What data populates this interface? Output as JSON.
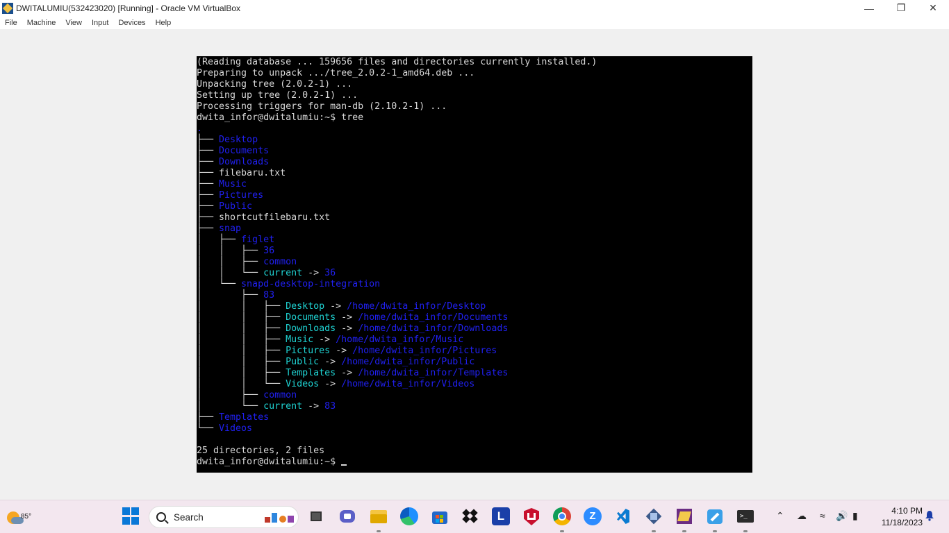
{
  "window": {
    "title": "DWITALUMIU(532423020) [Running] - Oracle VM VirtualBox",
    "controls": [
      "minimize-icon",
      "restore-icon",
      "close-icon"
    ]
  },
  "menu": [
    "File",
    "Machine",
    "View",
    "Input",
    "Devices",
    "Help"
  ],
  "terminal": {
    "lines": [
      [
        {
          "t": "(Reading database ... 159656 files and directories currently installed.)",
          "c": ""
        }
      ],
      [
        {
          "t": "Preparing to unpack .../tree_2.0.2-1_amd64.deb ...",
          "c": ""
        }
      ],
      [
        {
          "t": "Unpacking tree (2.0.2-1) ...",
          "c": ""
        }
      ],
      [
        {
          "t": "Setting up tree (2.0.2-1) ...",
          "c": ""
        }
      ],
      [
        {
          "t": "Processing triggers for man-db (2.10.2-1) ...",
          "c": ""
        }
      ],
      [
        {
          "t": "dwita_infor@dwitalumiu:~$ tree",
          "c": ""
        }
      ],
      [
        {
          "t": ".",
          "c": "dir"
        }
      ],
      [
        {
          "t": "├── ",
          "c": ""
        },
        {
          "t": "Desktop",
          "c": "dir"
        }
      ],
      [
        {
          "t": "├── ",
          "c": ""
        },
        {
          "t": "Documents",
          "c": "dir"
        }
      ],
      [
        {
          "t": "├── ",
          "c": ""
        },
        {
          "t": "Downloads",
          "c": "dir"
        }
      ],
      [
        {
          "t": "├── filebaru.txt",
          "c": ""
        }
      ],
      [
        {
          "t": "├── ",
          "c": ""
        },
        {
          "t": "Music",
          "c": "dir"
        }
      ],
      [
        {
          "t": "├── ",
          "c": ""
        },
        {
          "t": "Pictures",
          "c": "dir"
        }
      ],
      [
        {
          "t": "├── ",
          "c": ""
        },
        {
          "t": "Public",
          "c": "dir"
        }
      ],
      [
        {
          "t": "├── shortcutfilebaru.txt",
          "c": ""
        }
      ],
      [
        {
          "t": "├── ",
          "c": ""
        },
        {
          "t": "snap",
          "c": "dir"
        }
      ],
      [
        {
          "t": "│   ├── ",
          "c": ""
        },
        {
          "t": "figlet",
          "c": "dir"
        }
      ],
      [
        {
          "t": "│   │   ├── ",
          "c": ""
        },
        {
          "t": "36",
          "c": "dir"
        }
      ],
      [
        {
          "t": "│   │   ├── ",
          "c": ""
        },
        {
          "t": "common",
          "c": "dir"
        }
      ],
      [
        {
          "t": "│   │   └── ",
          "c": ""
        },
        {
          "t": "current",
          "c": "lnk"
        },
        {
          "t": " -> ",
          "c": ""
        },
        {
          "t": "36",
          "c": "tgt"
        }
      ],
      [
        {
          "t": "│   └── ",
          "c": ""
        },
        {
          "t": "snapd-desktop-integration",
          "c": "dir"
        }
      ],
      [
        {
          "t": "│       ├── ",
          "c": ""
        },
        {
          "t": "83",
          "c": "dir"
        }
      ],
      [
        {
          "t": "│       │   ├── ",
          "c": ""
        },
        {
          "t": "Desktop",
          "c": "lnk"
        },
        {
          "t": " -> ",
          "c": ""
        },
        {
          "t": "/home/dwita_infor/Desktop",
          "c": "tgt"
        }
      ],
      [
        {
          "t": "│       │   ├── ",
          "c": ""
        },
        {
          "t": "Documents",
          "c": "lnk"
        },
        {
          "t": " -> ",
          "c": ""
        },
        {
          "t": "/home/dwita_infor/Documents",
          "c": "tgt"
        }
      ],
      [
        {
          "t": "│       │   ├── ",
          "c": ""
        },
        {
          "t": "Downloads",
          "c": "lnk"
        },
        {
          "t": " -> ",
          "c": ""
        },
        {
          "t": "/home/dwita_infor/Downloads",
          "c": "tgt"
        }
      ],
      [
        {
          "t": "│       │   ├── ",
          "c": ""
        },
        {
          "t": "Music",
          "c": "lnk"
        },
        {
          "t": " -> ",
          "c": ""
        },
        {
          "t": "/home/dwita_infor/Music",
          "c": "tgt"
        }
      ],
      [
        {
          "t": "│       │   ├── ",
          "c": ""
        },
        {
          "t": "Pictures",
          "c": "lnk"
        },
        {
          "t": " -> ",
          "c": ""
        },
        {
          "t": "/home/dwita_infor/Pictures",
          "c": "tgt"
        }
      ],
      [
        {
          "t": "│       │   ├── ",
          "c": ""
        },
        {
          "t": "Public",
          "c": "lnk"
        },
        {
          "t": " -> ",
          "c": ""
        },
        {
          "t": "/home/dwita_infor/Public",
          "c": "tgt"
        }
      ],
      [
        {
          "t": "│       │   ├── ",
          "c": ""
        },
        {
          "t": "Templates",
          "c": "lnk"
        },
        {
          "t": " -> ",
          "c": ""
        },
        {
          "t": "/home/dwita_infor/Templates",
          "c": "tgt"
        }
      ],
      [
        {
          "t": "│       │   └── ",
          "c": ""
        },
        {
          "t": "Videos",
          "c": "lnk"
        },
        {
          "t": " -> ",
          "c": ""
        },
        {
          "t": "/home/dwita_infor/Videos",
          "c": "tgt"
        }
      ],
      [
        {
          "t": "│       ├── ",
          "c": ""
        },
        {
          "t": "common",
          "c": "dir"
        }
      ],
      [
        {
          "t": "│       └── ",
          "c": ""
        },
        {
          "t": "current",
          "c": "lnk"
        },
        {
          "t": " -> ",
          "c": ""
        },
        {
          "t": "83",
          "c": "tgt"
        }
      ],
      [
        {
          "t": "├── ",
          "c": ""
        },
        {
          "t": "Templates",
          "c": "dir"
        }
      ],
      [
        {
          "t": "└── ",
          "c": ""
        },
        {
          "t": "Videos",
          "c": "dir"
        }
      ],
      [
        {
          "t": "",
          "c": ""
        }
      ],
      [
        {
          "t": "25 directories, 2 files",
          "c": ""
        }
      ],
      [
        {
          "t": "dwita_infor@dwitalumiu:~$ ",
          "c": ""
        }
      ]
    ]
  },
  "taskbar": {
    "weather_temp": "85°",
    "search_label": "Search",
    "apps": [
      "start-icon",
      "task-view-icon",
      "chat-icon",
      "file-explorer-icon",
      "edge-icon",
      "store-icon",
      "dropbox-icon",
      "l-app-icon",
      "mcafee-icon",
      "chrome-icon",
      "zoom-icon",
      "vscode-icon",
      "virtualbox-icon",
      "winrar-icon",
      "paint-icon",
      "terminal-icon"
    ],
    "clock_time": "4:10 PM",
    "clock_date": "11/18/2023"
  },
  "colors": {
    "terminal_bg": "#000000",
    "terminal_fg": "#d8d8d8",
    "dir_blue": "#2020f0",
    "link_cyan": "#1fd3d3",
    "taskbar_bg": "#f3e7ef"
  }
}
